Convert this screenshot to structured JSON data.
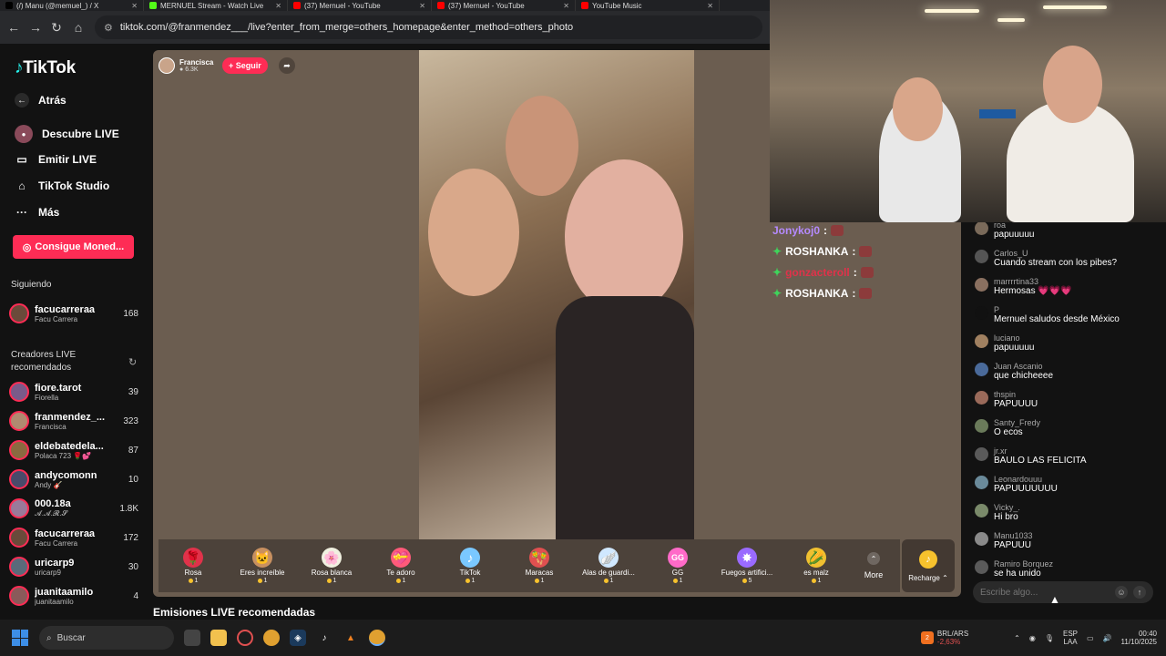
{
  "browser": {
    "tabs": [
      {
        "label": "(/) Manu (@memuel_) / X",
        "color": "#000000"
      },
      {
        "label": "MERNUEL Stream - Watch Live",
        "color": "#53fc18"
      },
      {
        "label": "(37) Mernuel - YouTube",
        "color": "#ff0000"
      },
      {
        "label": "(37) Mernuel - YouTube",
        "color": "#ff0000"
      },
      {
        "label": "YouTube Music",
        "color": "#ff0000"
      }
    ],
    "url": "tiktok.com/@franmendez___/live?enter_from_merge=others_homepage&enter_method=others_photo"
  },
  "sidebar": {
    "logo": "TikTok",
    "back": "Atrás",
    "nav": [
      {
        "label": "Descubre LIVE",
        "icon": "live-icon"
      },
      {
        "label": "Emitir LIVE",
        "icon": "camera-icon"
      },
      {
        "label": "TikTok Studio",
        "icon": "home-icon"
      },
      {
        "label": "Más",
        "icon": "more-icon"
      }
    ],
    "coins_button": "Consigue Moned...",
    "following_title": "Siguiendo",
    "following": [
      {
        "name": "facucarreraa",
        "sub": "Facu Carrera",
        "count": "168",
        "color": "#6a4a3a"
      }
    ],
    "recommended_title": "Creadores LIVE recomendados",
    "recommended": [
      {
        "name": "fiore.tarot",
        "sub": "Fiorella",
        "count": "39",
        "color": "#7a5a8a"
      },
      {
        "name": "franmendez_...",
        "sub": "Francisca",
        "count": "323",
        "color": "#b08a70"
      },
      {
        "name": "eldebatedela...",
        "sub": "Polaca 723 🌹💕",
        "count": "87",
        "color": "#8a6a40"
      },
      {
        "name": "andycomonn",
        "sub": "Andy 🎸",
        "count": "10",
        "color": "#4a4a6a"
      },
      {
        "name": "000.18a",
        "sub": "𝓐.𝓐.𝓡.𝓢",
        "count": "1.8K",
        "color": "#9a7a9a"
      },
      {
        "name": "facucarreraa",
        "sub": "Facu Carrera",
        "count": "172",
        "color": "#6a4a3a"
      },
      {
        "name": "uricarp9",
        "sub": "uricarp9",
        "count": "30",
        "color": "#5a6a7a"
      },
      {
        "name": "juanitaamilo",
        "sub": "juanitaamilo",
        "count": "4",
        "color": "#8a5a5a"
      }
    ]
  },
  "live": {
    "host_name": "Francisca",
    "host_followers": "6.3K",
    "follow_label": "+ Seguir",
    "gifts": [
      {
        "name": "Rosa",
        "price": "1",
        "glyph": "🌹",
        "color": "#e0324a"
      },
      {
        "name": "Eres increíble",
        "price": "1",
        "glyph": "🐱",
        "color": "#c89060"
      },
      {
        "name": "Rosa blanca",
        "price": "1",
        "glyph": "🌸",
        "color": "#f0f0e0"
      },
      {
        "name": "Te adoro",
        "price": "1",
        "glyph": "💝",
        "color": "#ff5a7a"
      },
      {
        "name": "TikTok",
        "price": "1",
        "glyph": "♪",
        "color": "#7ac8ff"
      },
      {
        "name": "Maracas",
        "price": "1",
        "glyph": "🪇",
        "color": "#e05050"
      },
      {
        "name": "Alas de guardi...",
        "price": "1",
        "glyph": "🪽",
        "color": "#d0e8ff"
      },
      {
        "name": "GG",
        "price": "1",
        "glyph": "GG",
        "color": "#ff6ac8"
      },
      {
        "name": "Fuegos artifici...",
        "price": "5",
        "glyph": "✸",
        "color": "#9a6aff"
      },
      {
        "name": "es malz",
        "price": "1",
        "glyph": "🌽",
        "color": "#f0c030"
      }
    ],
    "more_label": "More",
    "recharge_label": "Recharge",
    "recommended_streams": "Emisiones LIVE recomendadas"
  },
  "overlay_alerts": [
    {
      "user": "Jonykoj0",
      "color": "#b58aff"
    },
    {
      "user": "ROSHANKA",
      "color": "#ffffff"
    },
    {
      "user": "gonzacteroll",
      "color": "#e0324a"
    },
    {
      "user": "ROSHANKA",
      "color": "#ffffff"
    }
  ],
  "chat": {
    "messages": [
      {
        "user": "roa",
        "text": "papuuuuu",
        "color": "#7a6a5a"
      },
      {
        "user": "Carlos_U",
        "text": "Cuando stream con los pibes?",
        "color": "#555555"
      },
      {
        "user": "marrrrtina33",
        "text": "Hermosas 💗💗💗",
        "color": "#8a7060"
      },
      {
        "user": "P",
        "text": "Mernuel saludos desde México",
        "color": "#111111"
      },
      {
        "user": "luciano",
        "text": "papuuuuu",
        "color": "#a08060"
      },
      {
        "user": "Juan Ascanio",
        "text": "que chicheeee",
        "color": "#4a6a9a"
      },
      {
        "user": "thspin",
        "text": "PAPUUUU",
        "color": "#9a6a5a"
      },
      {
        "user": "Santy_Fredy",
        "text": "O ecos",
        "color": "#6a7a5a"
      },
      {
        "user": "jr.xr",
        "text": "BAULO LAS FELICITA",
        "color": "#5a5a5a"
      },
      {
        "user": "Leonardouuu",
        "text": "PAPUUUUUUU",
        "color": "#6a8a9a"
      },
      {
        "user": "Vicky_.",
        "text": "Hi bro",
        "color": "#7a8a6a"
      },
      {
        "user": "Manu1033",
        "text": "PAPUUU",
        "color": "#8a8a8a"
      },
      {
        "user": "Ramiro Borquez",
        "text": "se ha unido",
        "color": "#5a5a5a"
      }
    ],
    "input_placeholder": "Escribe algo..."
  },
  "taskbar": {
    "search_label": "Buscar",
    "ticker_label": "BRL/ARS",
    "ticker_value": "-2,63%",
    "ticker_badge": "2",
    "lang1": "ESP",
    "lang2": "LAA",
    "time": "00:40",
    "date": "11/10/2025"
  }
}
